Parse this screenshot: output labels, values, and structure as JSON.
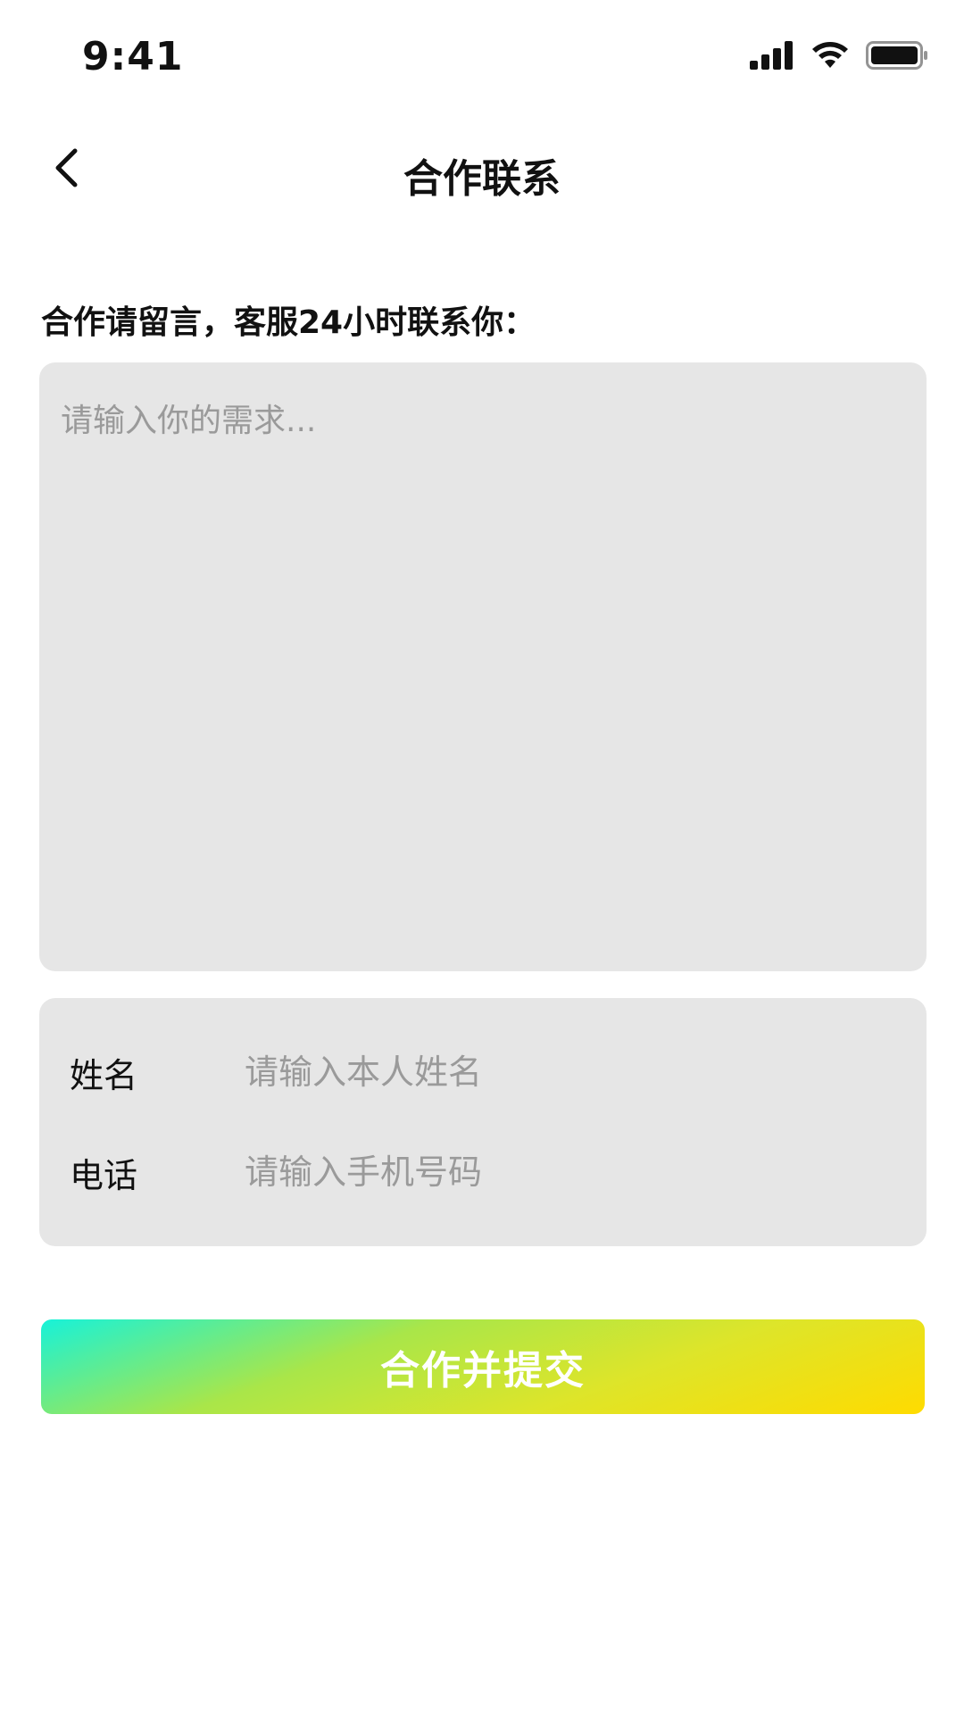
{
  "status_bar": {
    "time": "9:41",
    "icons": [
      "signal-icon",
      "wifi-icon",
      "battery-icon"
    ]
  },
  "nav": {
    "back_icon": "chevron-left-icon",
    "title": "合作联系"
  },
  "form": {
    "intro_label": "合作请留言，客服24小时联系你：",
    "need_placeholder": "请输入你的需求...",
    "name_label": "姓名",
    "name_placeholder": "请输入本人姓名",
    "phone_label": "电话",
    "phone_placeholder": "请输入手机号码",
    "submit_label": "合作并提交"
  },
  "colors": {
    "field_background": "#e6e6e6",
    "placeholder": "#9a9a9a",
    "gradient_start": "#17f2d9",
    "gradient_end": "#ffdb00"
  }
}
